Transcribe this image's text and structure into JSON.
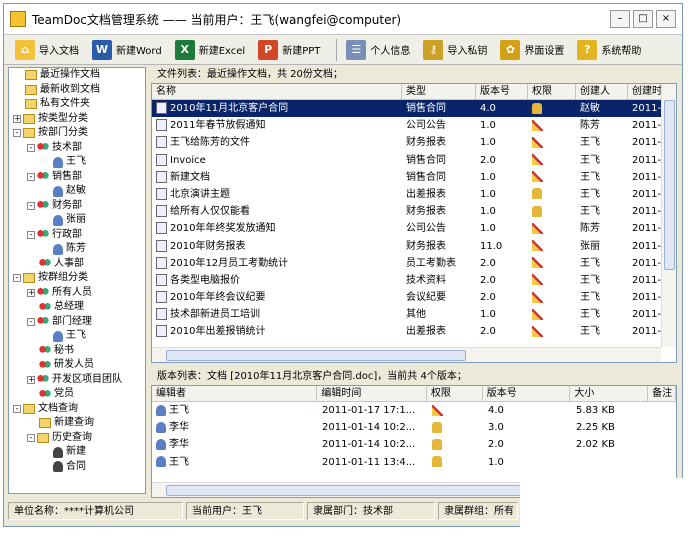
{
  "window": {
    "title": "TeamDoc文档管理系统 —— 当前用户：王飞(wangfei@computer)"
  },
  "toolbar": [
    {
      "label": "导入文档",
      "icon": "folder-open-icon"
    },
    {
      "label": "新建Word",
      "icon": "word-icon"
    },
    {
      "label": "新建Excel",
      "icon": "excel-icon"
    },
    {
      "label": "新建PPT",
      "icon": "powerpoint-icon"
    },
    {
      "label": "个人信息",
      "icon": "user-info-icon"
    },
    {
      "label": "导入私钥",
      "icon": "key-icon"
    },
    {
      "label": "界面设置",
      "icon": "settings-icon"
    },
    {
      "label": "系统帮助",
      "icon": "help-icon"
    }
  ],
  "tree": [
    {
      "label": "最近操作文档",
      "level": 0,
      "kind": "folder"
    },
    {
      "label": "最新收到文档",
      "level": 0,
      "kind": "folder"
    },
    {
      "label": "私有文件夹",
      "level": 0,
      "kind": "folder"
    },
    {
      "label": "按类型分类",
      "level": 0,
      "kind": "folder",
      "expander": "+"
    },
    {
      "label": "按部门分类",
      "level": 0,
      "kind": "folder",
      "expander": "-"
    },
    {
      "label": "技术部",
      "level": 1,
      "kind": "group",
      "expander": "-"
    },
    {
      "label": "王飞",
      "level": 2,
      "kind": "person"
    },
    {
      "label": "销售部",
      "level": 1,
      "kind": "group",
      "expander": "-"
    },
    {
      "label": "赵敏",
      "level": 2,
      "kind": "person"
    },
    {
      "label": "财务部",
      "level": 1,
      "kind": "group",
      "expander": "-"
    },
    {
      "label": "张丽",
      "level": 2,
      "kind": "person"
    },
    {
      "label": "行政部",
      "level": 1,
      "kind": "group",
      "expander": "-"
    },
    {
      "label": "陈芳",
      "level": 2,
      "kind": "person"
    },
    {
      "label": "人事部",
      "level": 1,
      "kind": "group"
    },
    {
      "label": "按群组分类",
      "level": 0,
      "kind": "folder",
      "expander": "-"
    },
    {
      "label": "所有人员",
      "level": 1,
      "kind": "team",
      "expander": "+"
    },
    {
      "label": "总经理",
      "level": 1,
      "kind": "team"
    },
    {
      "label": "部门经理",
      "level": 1,
      "kind": "team",
      "expander": "-"
    },
    {
      "label": "王飞",
      "level": 2,
      "kind": "person"
    },
    {
      "label": "秘书",
      "level": 1,
      "kind": "team"
    },
    {
      "label": "研发人员",
      "level": 1,
      "kind": "team"
    },
    {
      "label": "开发区项目团队",
      "level": 1,
      "kind": "team",
      "expander": "+"
    },
    {
      "label": "党员",
      "level": 1,
      "kind": "team"
    },
    {
      "label": "文档查询",
      "level": 0,
      "kind": "folder",
      "expander": "-"
    },
    {
      "label": "新建查询",
      "level": 1,
      "kind": "folder"
    },
    {
      "label": "历史查询",
      "level": 1,
      "kind": "folder",
      "expander": "-"
    },
    {
      "label": "新建",
      "level": 2,
      "kind": "search"
    },
    {
      "label": "合同",
      "level": 2,
      "kind": "search"
    }
  ],
  "files": {
    "caption": "文件列表：最近操作文档，共 20份文档；",
    "columns": [
      "名称",
      "类型",
      "版本号",
      "权限",
      "创建人",
      "创建时"
    ],
    "rows": [
      {
        "name": "2010年11月北京客户合同",
        "type": "销售合同",
        "ver": "4.0",
        "perm": "lock",
        "creator": "赵敏",
        "date": "2011-",
        "selected": true
      },
      {
        "name": "2011年春节放假通知",
        "type": "公司公告",
        "ver": "1.0",
        "perm": "edit",
        "creator": "陈芳",
        "date": "2011-"
      },
      {
        "name": "王飞给陈芳的文件",
        "type": "财务报表",
        "ver": "1.0",
        "perm": "edit",
        "creator": "王飞",
        "date": "2011-"
      },
      {
        "name": "Invoice",
        "type": "销售合同",
        "ver": "2.0",
        "perm": "edit",
        "creator": "王飞",
        "date": "2011-"
      },
      {
        "name": "新建文档",
        "type": "销售合同",
        "ver": "1.0",
        "perm": "edit",
        "creator": "王飞",
        "date": "2011-"
      },
      {
        "name": "北京演讲主题",
        "type": "出差报表",
        "ver": "1.0",
        "perm": "lock",
        "creator": "王飞",
        "date": "2011-"
      },
      {
        "name": "给所有人仅仅能看",
        "type": "财务报表",
        "ver": "1.0",
        "perm": "lock",
        "creator": "王飞",
        "date": "2011-"
      },
      {
        "name": "2010年年终奖发放通知",
        "type": "公司公告",
        "ver": "1.0",
        "perm": "edit",
        "creator": "陈芳",
        "date": "2011-"
      },
      {
        "name": "2010年财务报表",
        "type": "财务报表",
        "ver": "11.0",
        "perm": "edit",
        "creator": "张丽",
        "date": "2011-"
      },
      {
        "name": "2010年12月员工考勤统计",
        "type": "员工考勤表",
        "ver": "2.0",
        "perm": "edit",
        "creator": "王飞",
        "date": "2011-"
      },
      {
        "name": "各类型电脑报价",
        "type": "技术资料",
        "ver": "2.0",
        "perm": "edit",
        "creator": "王飞",
        "date": "2011-"
      },
      {
        "name": "2010年年终会议纪要",
        "type": "会议纪要",
        "ver": "2.0",
        "perm": "edit",
        "creator": "王飞",
        "date": "2011-"
      },
      {
        "name": "技术部新进员工培训",
        "type": "其他",
        "ver": "1.0",
        "perm": "edit",
        "creator": "王飞",
        "date": "2011-"
      },
      {
        "name": "2010年出差报销统计",
        "type": "出差报表",
        "ver": "2.0",
        "perm": "edit",
        "creator": "王飞",
        "date": "2011-"
      }
    ]
  },
  "versions": {
    "caption": "版本列表：文档 [2010年11月北京客户合同.doc]，当前共 4个版本；",
    "columns": [
      "编辑者",
      "编辑时间",
      "权限",
      "版本号",
      "大小",
      "备注"
    ],
    "rows": [
      {
        "editor": "王飞",
        "time": "2011-01-17 17:1...",
        "perm": "edit",
        "ver": "4.0",
        "size": "5.83 KB"
      },
      {
        "editor": "李华",
        "time": "2011-01-14 10:2...",
        "perm": "lock",
        "ver": "3.0",
        "size": "2.25 KB"
      },
      {
        "editor": "李华",
        "time": "2011-01-14 10:2...",
        "perm": "lock",
        "ver": "2.0",
        "size": "2.02 KB"
      },
      {
        "editor": "王飞",
        "time": "2011-01-11 13:4...",
        "perm": "lock",
        "ver": "1.0",
        "size": ""
      }
    ]
  },
  "status": {
    "org": "单位名称：****计算机公司",
    "user": "当前用户：王飞",
    "dept": "隶属部门：技术部",
    "group": "隶属群组：所有"
  }
}
